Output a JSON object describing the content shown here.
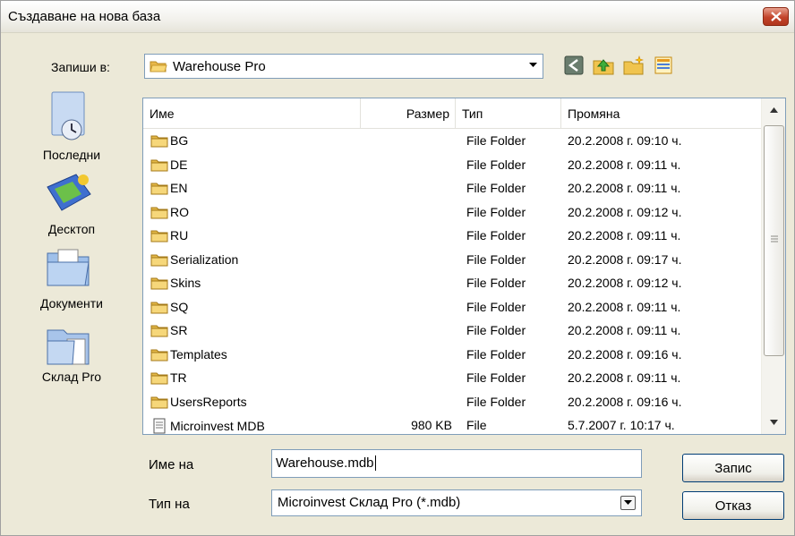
{
  "window": {
    "title": "Създаване на нова база"
  },
  "toolbar": {
    "save_in_label": "Запиши в:",
    "save_in_value": "Warehouse Pro"
  },
  "places": [
    {
      "label": "Последни",
      "icon": "recent-clock-icon"
    },
    {
      "label": "Десктоп",
      "icon": "desktop-icon"
    },
    {
      "label": "Документи",
      "icon": "documents-folder-icon"
    },
    {
      "label": "Склад Pro",
      "icon": "folder-icon"
    }
  ],
  "columns": [
    "Име",
    "Размер",
    "Тип",
    "Промяна"
  ],
  "files": [
    {
      "name": "BG",
      "size": "",
      "type": "File Folder",
      "modified": "20.2.2008 г. 09:10 ч."
    },
    {
      "name": "DE",
      "size": "",
      "type": "File Folder",
      "modified": "20.2.2008 г. 09:11 ч."
    },
    {
      "name": "EN",
      "size": "",
      "type": "File Folder",
      "modified": "20.2.2008 г. 09:11 ч."
    },
    {
      "name": "RO",
      "size": "",
      "type": "File Folder",
      "modified": "20.2.2008 г. 09:12 ч."
    },
    {
      "name": "RU",
      "size": "",
      "type": "File Folder",
      "modified": "20.2.2008 г. 09:11 ч."
    },
    {
      "name": "Serialization",
      "size": "",
      "type": "File Folder",
      "modified": "20.2.2008 г. 09:17 ч."
    },
    {
      "name": "Skins",
      "size": "",
      "type": "File Folder",
      "modified": "20.2.2008 г. 09:12 ч."
    },
    {
      "name": "SQ",
      "size": "",
      "type": "File Folder",
      "modified": "20.2.2008 г. 09:11 ч."
    },
    {
      "name": "SR",
      "size": "",
      "type": "File Folder",
      "modified": "20.2.2008 г. 09:11 ч."
    },
    {
      "name": "Templates",
      "size": "",
      "type": "File Folder",
      "modified": "20.2.2008 г. 09:16 ч."
    },
    {
      "name": "TR",
      "size": "",
      "type": "File Folder",
      "modified": "20.2.2008 г. 09:11 ч."
    },
    {
      "name": "UsersReports",
      "size": "",
      "type": "File Folder",
      "modified": "20.2.2008 г. 09:16 ч."
    },
    {
      "name": "Microinvest MDB",
      "size": "980 KB",
      "type": "File",
      "modified": "5.7.2007 г. 10:17 ч."
    }
  ],
  "form": {
    "filename_label": "Име на",
    "filename_value": "Warehouse.mdb",
    "filetype_label": "Тип на",
    "filetype_value": "Microinvest Склад Pro (*.mdb)"
  },
  "buttons": {
    "save": "Запис",
    "cancel": "Отказ"
  },
  "colors": {
    "dialog_bg": "#ece9d8",
    "input_border": "#7f9db9",
    "folder_yellow": "#f3d36b",
    "close_red": "#c2442a"
  }
}
